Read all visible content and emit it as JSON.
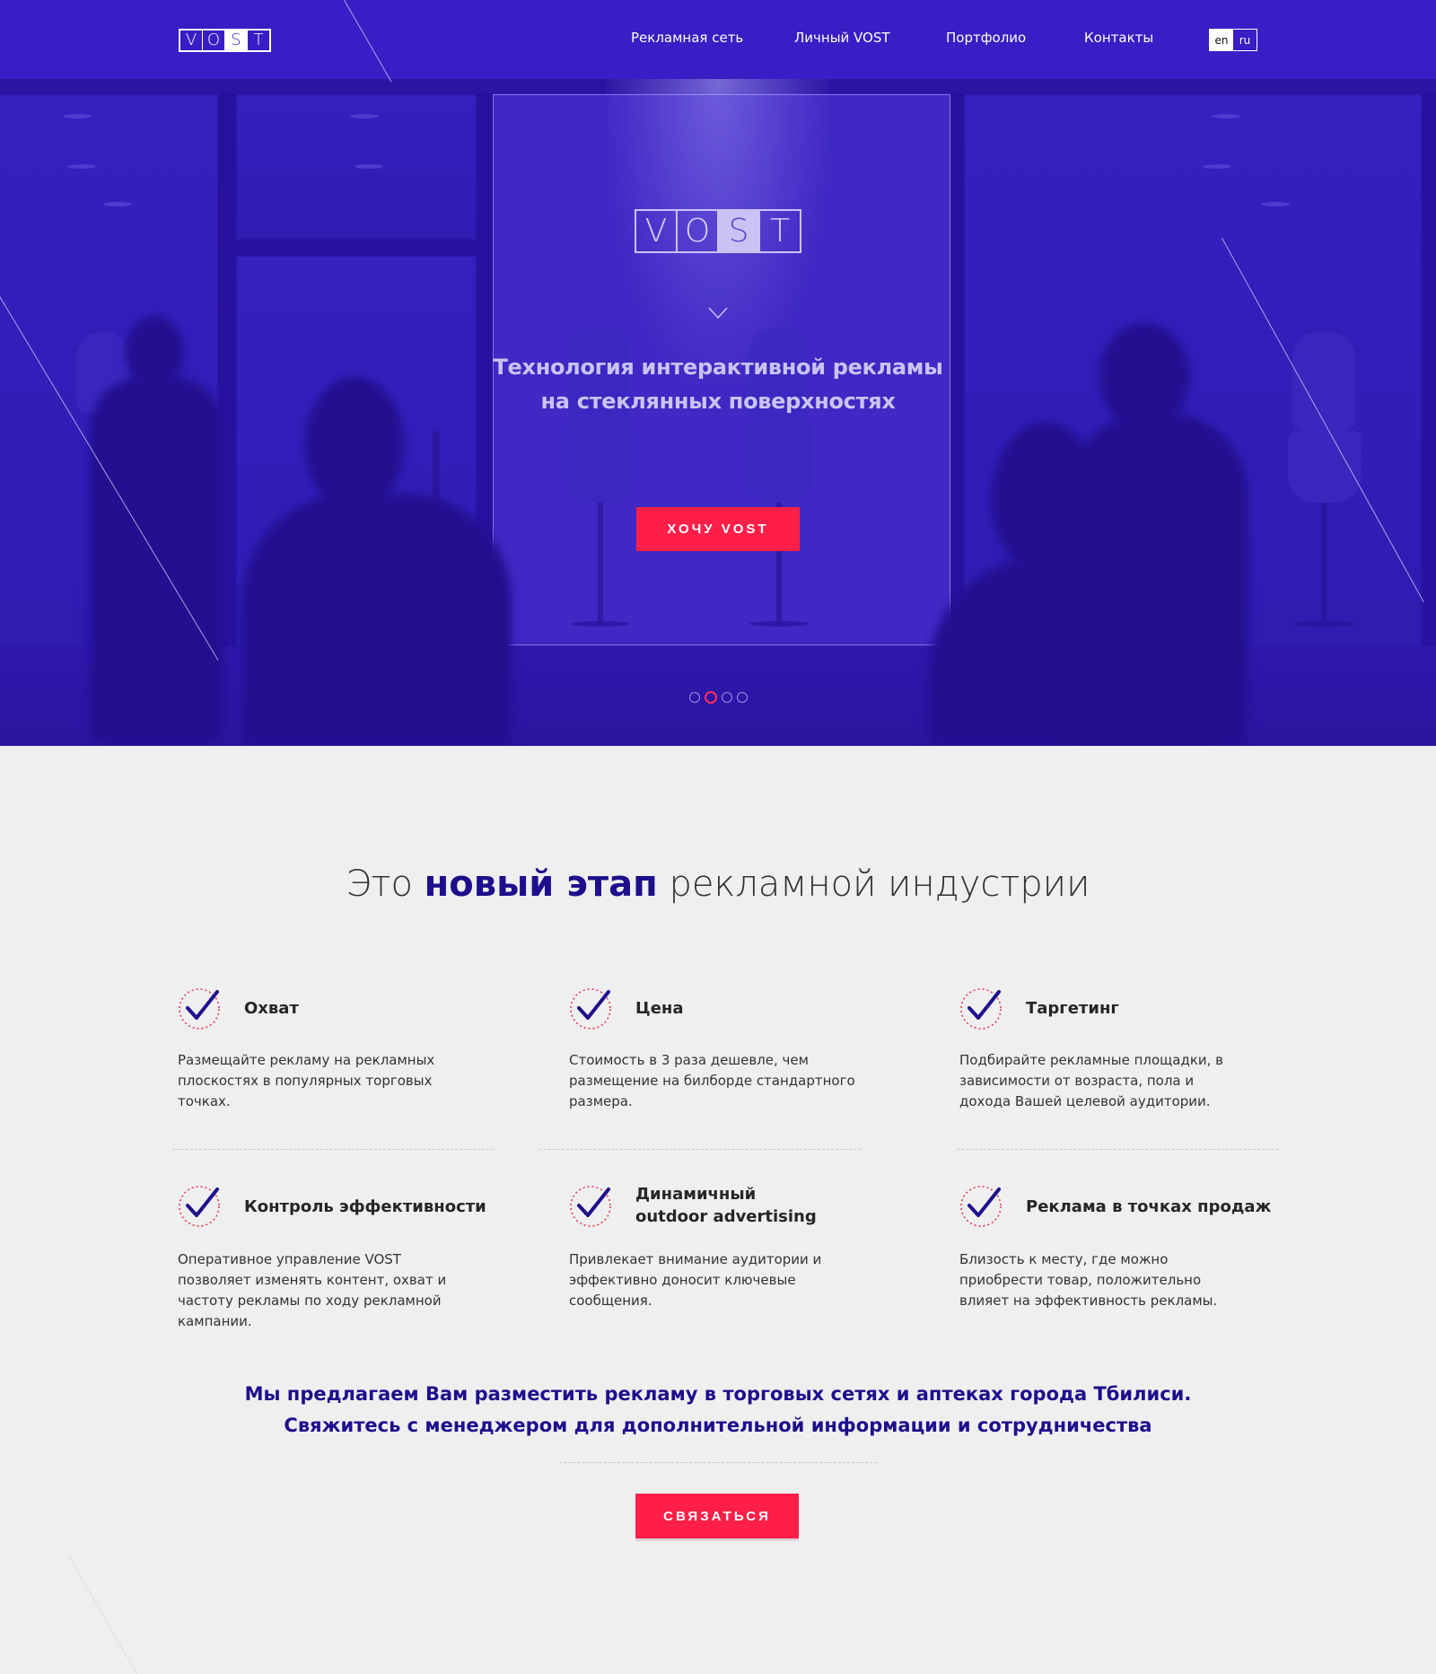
{
  "header": {
    "logo_letters": [
      "V",
      "O",
      "S",
      "T"
    ],
    "nav": [
      "Рекламная сеть",
      "Личный VOST",
      "Портфолио",
      "Контакты"
    ],
    "lang": {
      "en": "en",
      "ru": "ru"
    }
  },
  "hero": {
    "logo_letters": [
      "V",
      "O",
      "S",
      "T"
    ],
    "title_line1": "Технология интерактивной рекламы",
    "title_line2": "на стеклянных поверхностях",
    "cta": "ХОЧУ VOST",
    "slides": 4,
    "active_slide": 2
  },
  "features": {
    "title_pre": "Это",
    "title_bold": "новый этап",
    "title_post": "рекламной индустрии",
    "items": [
      {
        "title": "Охват",
        "text": "Размещайте рекламу на рекламных плоскостях в популярных торговых точках."
      },
      {
        "title": "Цена",
        "text": "Стоимость в 3 раза дешевле, чем размещение на билборде стандартного размера."
      },
      {
        "title": "Таргетинг",
        "text": "Подбирайте рекламные площадки, в зависимости от возраста, пола и дохода Вашей целевой аудитории."
      },
      {
        "title": "Контроль эффективности",
        "text": "Оперативное управление VOST позволяет изменять контент, охват и частоту рекламы по ходу рекламной кампании."
      },
      {
        "title_line1": "Динамичный",
        "title_line2": "outdoor advertising",
        "text": "Привлекает внимание аудитории и эффективно доносит ключевые сообщения."
      },
      {
        "title": "Реклама в точках продаж",
        "text": "Близость к месту, где можно приобрести товар, положительно влияет на эффективность рекламы."
      }
    ]
  },
  "offer": {
    "text": "Мы предлагаем Вам разместить рекламу в торговых сетях и аптеках города Тбилиси. Свяжитесь с менеджером для дополнительной информации и сотрудничества",
    "cta": "СВЯЗАТЬСЯ"
  },
  "colors": {
    "hero_bg": "#3219b9",
    "accent_red": "#ff1f48",
    "accent_blue": "#1d0f8c",
    "page_bg": "#efefef"
  },
  "icons": [
    "check-circle-icon",
    "chevron-down-icon"
  ]
}
